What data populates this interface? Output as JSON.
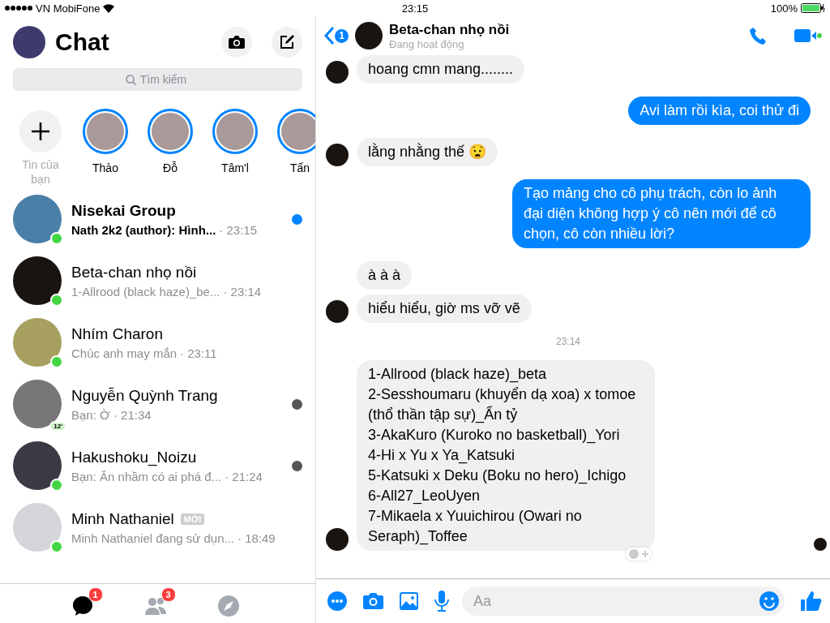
{
  "status_bar": {
    "carrier": "VN MobiFone",
    "time": "23:15",
    "battery": "100%"
  },
  "sidebar": {
    "title": "Chat",
    "search": {
      "placeholder": "Tìm kiếm"
    },
    "stories": [
      {
        "kind": "add",
        "label": "Tin của bạn"
      },
      {
        "kind": "story",
        "label": "Thảo"
      },
      {
        "kind": "story",
        "label": "Đỗ"
      },
      {
        "kind": "story",
        "label": "Tâm'l"
      },
      {
        "kind": "story",
        "label": "Tấn"
      }
    ],
    "conversations": [
      {
        "name": "Nisekai Group",
        "preview": "Nath 2k2 (author): Hình...",
        "time": "· 23:15",
        "unread": true,
        "online": true,
        "seen": false
      },
      {
        "name": "Beta-chan nhọ nồi",
        "preview": "1-Allrood (black haze)_be...",
        "time": "· 23:14",
        "unread": false,
        "online": true,
        "seen": false
      },
      {
        "name": "Nhím Charon",
        "preview": "Chúc anh may mắn",
        "time": "· 23:11",
        "unread": false,
        "online": true,
        "seen": false
      },
      {
        "name": "Nguyễn Quỳnh Trang",
        "preview": "Bạn: Ờ",
        "time": "· 21:34",
        "unread": false,
        "online": false,
        "active_ago": "12'",
        "seen": true
      },
      {
        "name": "Hakushoku_Noizu",
        "preview": "Bạn: Ăn nhầm có ai phá đ...",
        "time": "· 21:24",
        "unread": false,
        "online": true,
        "seen": true
      },
      {
        "name": "Minh Nathaniel",
        "badge": "MỚI",
        "preview": "Minh Nathaniel đang sử dụn...",
        "time": "· 18:49",
        "unread": false,
        "online": true,
        "seen": false
      }
    ],
    "tabs": [
      {
        "kind": "chats",
        "badge": "1",
        "selected": true
      },
      {
        "kind": "people",
        "badge": "3",
        "selected": false
      },
      {
        "kind": "discover",
        "selected": false
      }
    ]
  },
  "chat": {
    "back_count": "1",
    "name": "Beta-chan nhọ nồi",
    "subtitle": "Đang hoạt động",
    "messages": [
      {
        "kind": "incoming",
        "text": "hoang cmn mang........",
        "avatar": true
      },
      {
        "kind": "outgoing",
        "text": "Avi làm rồi kìa, coi thử đi"
      },
      {
        "kind": "incoming",
        "text": "lằng nhằng thế 😧",
        "avatar": true
      },
      {
        "kind": "outgoing",
        "text": "Tạo mảng cho cô phụ trách, còn lo ảnh đại diện không hợp ý cô nên mới để cô chọn, cô còn nhiều lời?"
      },
      {
        "kind": "incoming",
        "text": "à à à",
        "avatar": false
      },
      {
        "kind": "incoming",
        "text": "hiểu hiểu, giờ ms vỡ vẽ",
        "avatar": true
      },
      {
        "kind": "timestamp",
        "text": "23:14"
      },
      {
        "kind": "incoming",
        "text": "1-Allrood (black haze)_beta\n2-Sesshoumaru (khuyển dạ xoa) x tomoe (thổ thần tập sự)_Ẩn tỷ\n3-AkaKuro (Kuroko no basketball)_Yori\n4-Hi x Yu x Ya_Katsuki\n5-Katsuki x Deku (Boku no hero)_Ichigo\n6-All27_LeoUyen\n7-Mikaela x Yuuichirou (Owari no Seraph)_Toffee",
        "avatar": true,
        "seen": true,
        "reaction_button": true
      }
    ],
    "composer": {
      "placeholder": "Aa"
    }
  }
}
